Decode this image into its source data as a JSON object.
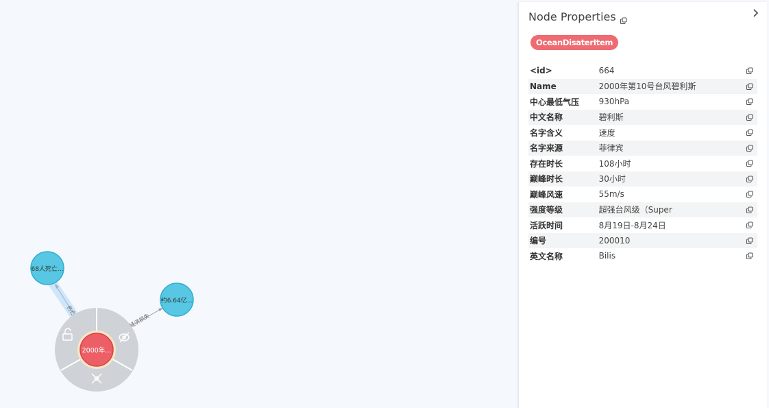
{
  "graph": {
    "center_node": "2000年...",
    "nodes": [
      {
        "label": "68人死亡..."
      },
      {
        "label": "约6.64亿..."
      }
    ],
    "edges": [
      {
        "label": "伤亡率"
      },
      {
        "label": "经济损失"
      }
    ],
    "colors": {
      "center_node": "#ec5f66",
      "neighbor_node": "#57c7e3",
      "menu_ring": "#cfd3d8",
      "highlight_ring": "#f7e6c4"
    }
  },
  "panel": {
    "title": "Node Properties",
    "collapse_icon": "chevron-right-icon",
    "label_badge": "OceanDisaterItem",
    "badge_color": "#ef6b72",
    "properties": [
      {
        "key": "<id>",
        "value": "664"
      },
      {
        "key": "Name",
        "value": "2000年第10号台风碧利斯"
      },
      {
        "key": "中心最低气压",
        "value": "930hPa"
      },
      {
        "key": "中文名称",
        "value": "碧利斯"
      },
      {
        "key": "名字含义",
        "value": "速度"
      },
      {
        "key": "名字来源",
        "value": "菲律宾"
      },
      {
        "key": "存在时长",
        "value": "108小时"
      },
      {
        "key": "巅峰时长",
        "value": "30小时"
      },
      {
        "key": "巅峰风速",
        "value": "55m/s"
      },
      {
        "key": "强度等级",
        "value": "超强台风级（Super"
      },
      {
        "key": "活跃时间",
        "value": "8月19日-8月24日"
      },
      {
        "key": "编号",
        "value": "200010"
      },
      {
        "key": "英文名称",
        "value": "Bilis"
      }
    ]
  }
}
